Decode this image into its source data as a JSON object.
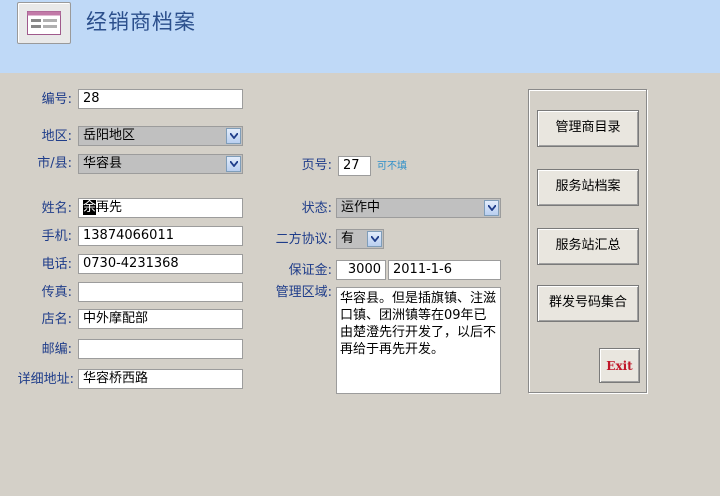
{
  "header": {
    "title": "经销商档案"
  },
  "labels": {
    "id": "编号:",
    "region": "地区:",
    "city": "市/县:",
    "page_no": "页号:",
    "name": "姓名:",
    "status": "状态:",
    "mobile": "手机:",
    "agreement": "二方协议:",
    "phone": "电话:",
    "deposit": "保证金:",
    "fax": "传真:",
    "area": "管理区域:",
    "store": "店名:",
    "postcode": "邮编:",
    "address": "详细地址:"
  },
  "fields": {
    "id": "28",
    "region": "岳阳地区",
    "city": "华容县",
    "page_no": "27",
    "page_note": "可不填",
    "name_first": "余",
    "name_rest": "再先",
    "status": "运作中",
    "mobile": "13874066011",
    "agreement": "有",
    "phone": "0730-4231368",
    "deposit_amount": "3000",
    "deposit_date": "2011-1-6",
    "fax": "",
    "store": "中外摩配部",
    "postcode": "",
    "address": "华容桥西路",
    "area": "华容县。但是插旗镇、注滋口镇、团洲镇等在09年已由楚澄先行开发了，以后不再给于再先开发。"
  },
  "buttons": {
    "dealer_list": "管理商目录",
    "station_archive": "服务站档案",
    "station_summary": "服务站汇总",
    "group_sms": "群发号码集合",
    "exit": "Exit"
  },
  "colors": {
    "header_bg": "#bfd9f7",
    "form_bg": "#d4d0c8",
    "title": "#2b4f8c",
    "label": "#1f3d8a",
    "exit": "#c0182a",
    "note": "#2e8fc9"
  },
  "icons": {
    "form_icon": "form-icon",
    "dropdown": "chevron-down-icon"
  }
}
